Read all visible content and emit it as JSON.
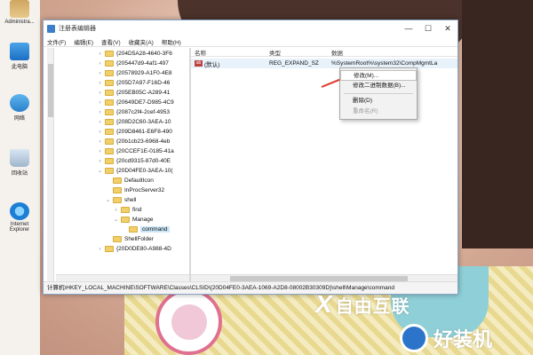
{
  "desktop": {
    "icons": [
      {
        "label": "Administra...",
        "icon": "user-folder-icon"
      },
      {
        "label": "此电脑",
        "icon": "computer-icon"
      },
      {
        "label": "网络",
        "icon": "network-icon"
      },
      {
        "label": "回收站",
        "icon": "recycle-bin-icon"
      },
      {
        "label": "Internet Explorer",
        "icon": "internet-explorer-icon"
      }
    ]
  },
  "window": {
    "title": "注册表编辑器",
    "controls": {
      "minimize": "—",
      "maximize": "☐",
      "close": "✕"
    },
    "menu": [
      "文件(F)",
      "编辑(E)",
      "查看(V)",
      "收藏夹(A)",
      "帮助(H)"
    ],
    "tree": [
      {
        "label": "{204D5A28-4640-3F6",
        "expand": "›",
        "indent": 0
      },
      {
        "label": "{205447d9-4af1-497",
        "expand": "›",
        "indent": 0
      },
      {
        "label": "{20578929-A1F0-4E8",
        "expand": "›",
        "indent": 0
      },
      {
        "label": "{205D7A97-F16D-46",
        "expand": "›",
        "indent": 0
      },
      {
        "label": "{205EB05C-A289-41",
        "expand": "›",
        "indent": 0
      },
      {
        "label": "{20649DE7-D985-4C9",
        "expand": "›",
        "indent": 0
      },
      {
        "label": "{2087c2f4-2cef-4953",
        "expand": "›",
        "indent": 0
      },
      {
        "label": "{208D2C60-3AEA-10",
        "expand": "›",
        "indent": 0
      },
      {
        "label": "{209D8461-E6F8-490",
        "expand": "›",
        "indent": 0
      },
      {
        "label": "{20b1cb23-6968-4eb",
        "expand": "›",
        "indent": 0
      },
      {
        "label": "{20CCEF1E-0185-41a",
        "expand": "›",
        "indent": 0
      },
      {
        "label": "{20cd9315-87d0-40E",
        "expand": "›",
        "indent": 0
      },
      {
        "label": "{20D04FE0-3AEA-10(",
        "expand": "⌄",
        "indent": 0
      },
      {
        "label": "DefaultIcon",
        "expand": "",
        "indent": 1
      },
      {
        "label": "InProcServer32",
        "expand": "",
        "indent": 1
      },
      {
        "label": "shell",
        "expand": "⌄",
        "indent": 1
      },
      {
        "label": "find",
        "expand": "›",
        "indent": 2
      },
      {
        "label": "Manage",
        "expand": "⌄",
        "indent": 2
      },
      {
        "label": "command",
        "expand": "",
        "indent": 3,
        "selected": true
      },
      {
        "label": "ShellFolder",
        "expand": "",
        "indent": 1
      },
      {
        "label": "{20D0DE80-A988-4D",
        "expand": "›",
        "indent": 0
      }
    ],
    "columns": {
      "name": "名称",
      "type": "类型",
      "data": "数据"
    },
    "values": [
      {
        "name": "(默认)",
        "type": "REG_EXPAND_SZ",
        "data": "%SystemRoot%\\system32\\CompMgmtLa"
      }
    ],
    "context_menu": [
      {
        "label": "修改(M)...",
        "state": "highlighted"
      },
      {
        "label": "修改二进制数据(B)...",
        "state": "normal"
      },
      {
        "label": "---"
      },
      {
        "label": "删除(D)",
        "state": "normal"
      },
      {
        "label": "重命名(R)",
        "state": "disabled"
      }
    ],
    "status_path": "计算机\\HKEY_LOCAL_MACHINE\\SOFTWARE\\Classes\\CLSID\\{20D04FE0-3AEA-1069-A2D8-08002B30309D}\\shell\\Manage\\command"
  },
  "watermarks": {
    "brand1": "自由互联",
    "brand2": "好装机"
  },
  "colors": {
    "annotation_arrow": "#e0382a",
    "selection": "#cde6f7",
    "folder": "#f1cf6b"
  }
}
